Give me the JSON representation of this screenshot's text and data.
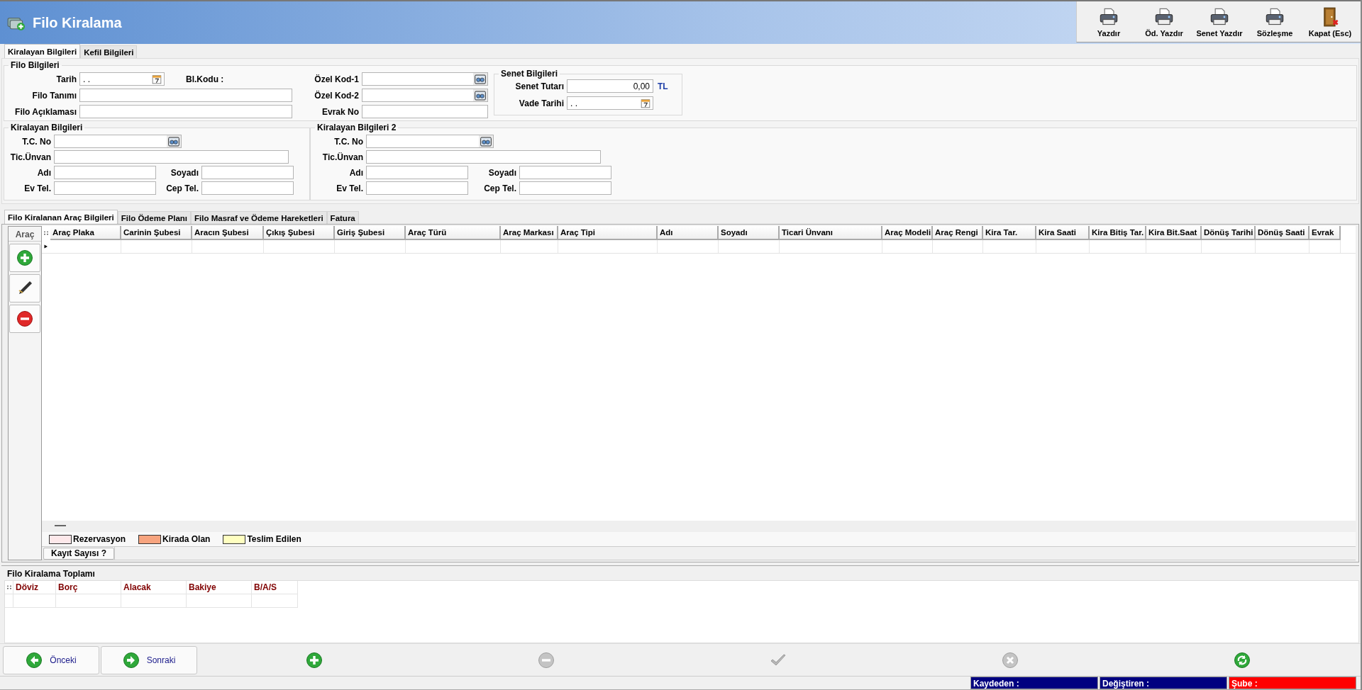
{
  "window": {
    "title": "Filo Kiralama"
  },
  "toolbar": [
    {
      "label": "Yazdır",
      "kind": "print"
    },
    {
      "label": "Öd. Yazdır",
      "kind": "print"
    },
    {
      "label": "Senet Yazdır",
      "kind": "print"
    },
    {
      "label": "Sözleşme",
      "kind": "print"
    },
    {
      "label": "Kapat (Esc)",
      "kind": "door"
    }
  ],
  "tabs": [
    {
      "label": "Kiralayan Bilgileri",
      "selected": true
    },
    {
      "label": "Kefil Bilgileri",
      "selected": false
    }
  ],
  "filo": {
    "title": "Filo Bilgileri",
    "date": {
      "label": "Tarih",
      "value": ". ."
    },
    "branch_code_label": "Bl.Kodu :",
    "name": {
      "label": "Filo Tanımı"
    },
    "description": {
      "label": "Filo Açıklaması"
    },
    "special_code_1": {
      "label": "Özel Kod-1"
    },
    "special_code_2": {
      "label": "Özel Kod-2"
    },
    "document_no": {
      "label": "Evrak No"
    }
  },
  "senet": {
    "title": "Senet Bilgileri",
    "amount": {
      "label": "Senet Tutarı",
      "value": "0,00",
      "currency": "TL"
    },
    "due_date": {
      "label": "Vade Tarihi",
      "value": ". ."
    }
  },
  "renters": [
    {
      "title": "Kiralayan Bilgileri",
      "tc_no": "T.C. No",
      "trade_name": "Tic.Ünvan",
      "first_name": "Adı",
      "last_name": "Soyadı",
      "home_phone": "Ev Tel.",
      "mobile_phone": "Cep Tel."
    },
    {
      "title": "Kiralayan Bilgileri 2",
      "tc_no": "T.C. No",
      "trade_name": "Tic.Ünvan",
      "first_name": "Adı",
      "last_name": "Soyadı",
      "home_phone": "Ev Tel.",
      "mobile_phone": "Cep Tel."
    }
  ],
  "detail_tabs": [
    {
      "label": "Filo Kiralanan Araç Bilgileri",
      "selected": true
    },
    {
      "label": "Filo Ödeme Planı",
      "selected": false
    },
    {
      "label": "Filo Masraf ve Ödeme Hareketleri",
      "selected": false
    },
    {
      "label": "Fatura",
      "selected": false
    }
  ],
  "vehicle_panel": {
    "title": "Araç",
    "tools": [
      {
        "kind": "add"
      },
      {
        "kind": "edit"
      },
      {
        "kind": "delete"
      }
    ]
  },
  "grid": {
    "columns": [
      "Araç Plaka",
      "Carinin Şubesi",
      "Aracın Şubesi",
      "Çıkış Şubesi",
      "Giriş Şubesi",
      "Araç Türü",
      "Araç Markası",
      "Araç Tipi",
      "Adı",
      "Soyadı",
      "Ticari Ünvanı",
      "Araç Modeli",
      "Araç Rengi",
      "Kira Tar.",
      "Kira Saati",
      "Kira Bitiş Tar.",
      "Kira Bit.Saat",
      "Dönüş Tarihi",
      "Dönüş Saati",
      "Evrak"
    ]
  },
  "legend": [
    {
      "label": "Rezervasyon",
      "color": "#fde8ea"
    },
    {
      "label": "Kirada Olan",
      "color": "#f7a47f"
    },
    {
      "label": "Teslim Edilen",
      "color": "#ffffc0"
    }
  ],
  "record_count": "Kayıt Sayısı ?",
  "totals": {
    "title": "Filo Kiralama Toplamı",
    "columns": [
      "Döviz",
      "Borç",
      "Alacak",
      "Bakiye",
      "B/A/S"
    ]
  },
  "nav": [
    {
      "label": "Önceki",
      "kind": "prev"
    },
    {
      "label": "Sonraki",
      "kind": "next"
    }
  ],
  "actions": [
    {
      "kind": "add",
      "disabled": false
    },
    {
      "kind": "delete",
      "disabled": true
    },
    {
      "kind": "save",
      "disabled": true
    },
    {
      "kind": "cancel",
      "disabled": true
    },
    {
      "kind": "refresh",
      "disabled": false
    }
  ],
  "status_bar": [
    {
      "label": "Kaydeden :",
      "color": "#000080"
    },
    {
      "label": "Değiştiren :",
      "color": "#000080"
    },
    {
      "label": "Şube :",
      "color": "#ff0000"
    }
  ]
}
